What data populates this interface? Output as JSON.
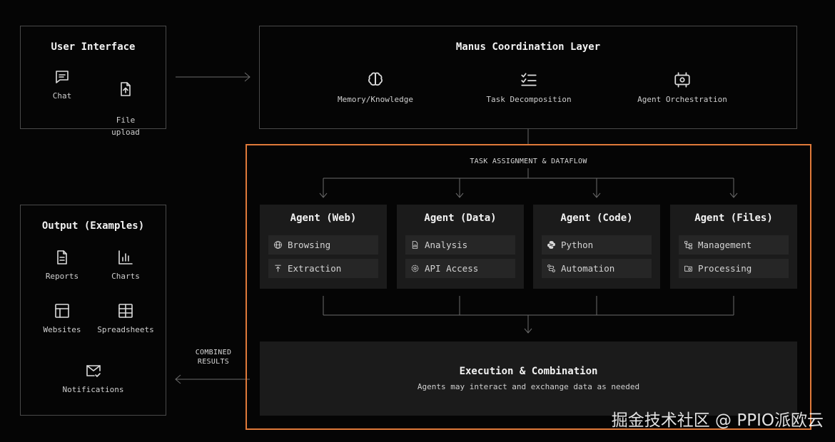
{
  "user_interface": {
    "title": "User Interface",
    "items": [
      {
        "label": "Chat",
        "icon": "chat-icon"
      },
      {
        "label": "File\nupload",
        "icon": "file-upload-icon"
      }
    ]
  },
  "coordination": {
    "title": "Manus Coordination Layer",
    "items": [
      {
        "label": "Memory/Knowledge",
        "icon": "brain-icon"
      },
      {
        "label": "Task Decomposition",
        "icon": "checklist-icon"
      },
      {
        "label": "Agent Orchestration",
        "icon": "orchestration-icon"
      }
    ]
  },
  "dataflow_label": "TASK ASSIGNMENT & DATAFLOW",
  "agents": [
    {
      "title": "Agent (Web)",
      "capabilities": [
        {
          "label": "Browsing",
          "icon": "globe-icon"
        },
        {
          "label": "Extraction",
          "icon": "extract-icon"
        }
      ]
    },
    {
      "title": "Agent (Data)",
      "capabilities": [
        {
          "label": "Analysis",
          "icon": "file-chart-icon"
        },
        {
          "label": "API Access",
          "icon": "gear-icon"
        }
      ]
    },
    {
      "title": "Agent (Code)",
      "capabilities": [
        {
          "label": "Python",
          "icon": "python-icon"
        },
        {
          "label": "Automation",
          "icon": "route-icon"
        }
      ]
    },
    {
      "title": "Agent (Files)",
      "capabilities": [
        {
          "label": "Management",
          "icon": "tree-icon"
        },
        {
          "label": "Processing",
          "icon": "folder-gear-icon"
        }
      ]
    }
  ],
  "execution": {
    "title": "Execution & Combination",
    "subtitle": "Agents may interact and exchange data as needed"
  },
  "combined_label": "COMBINED\nRESULTS",
  "output": {
    "title": "Output (Examples)",
    "items": [
      {
        "label": "Reports",
        "icon": "report-icon"
      },
      {
        "label": "Charts",
        "icon": "bar-chart-icon"
      },
      {
        "label": "Websites",
        "icon": "layout-icon"
      },
      {
        "label": "Spreadsheets",
        "icon": "table-icon"
      },
      {
        "label": "Notifications",
        "icon": "mail-check-icon"
      }
    ]
  },
  "watermark": "掘金技术社区 @ PPIO派欧云",
  "colors": {
    "accent_border": "#e07a3a",
    "background": "#050505",
    "panel": "#1b1b1b"
  }
}
